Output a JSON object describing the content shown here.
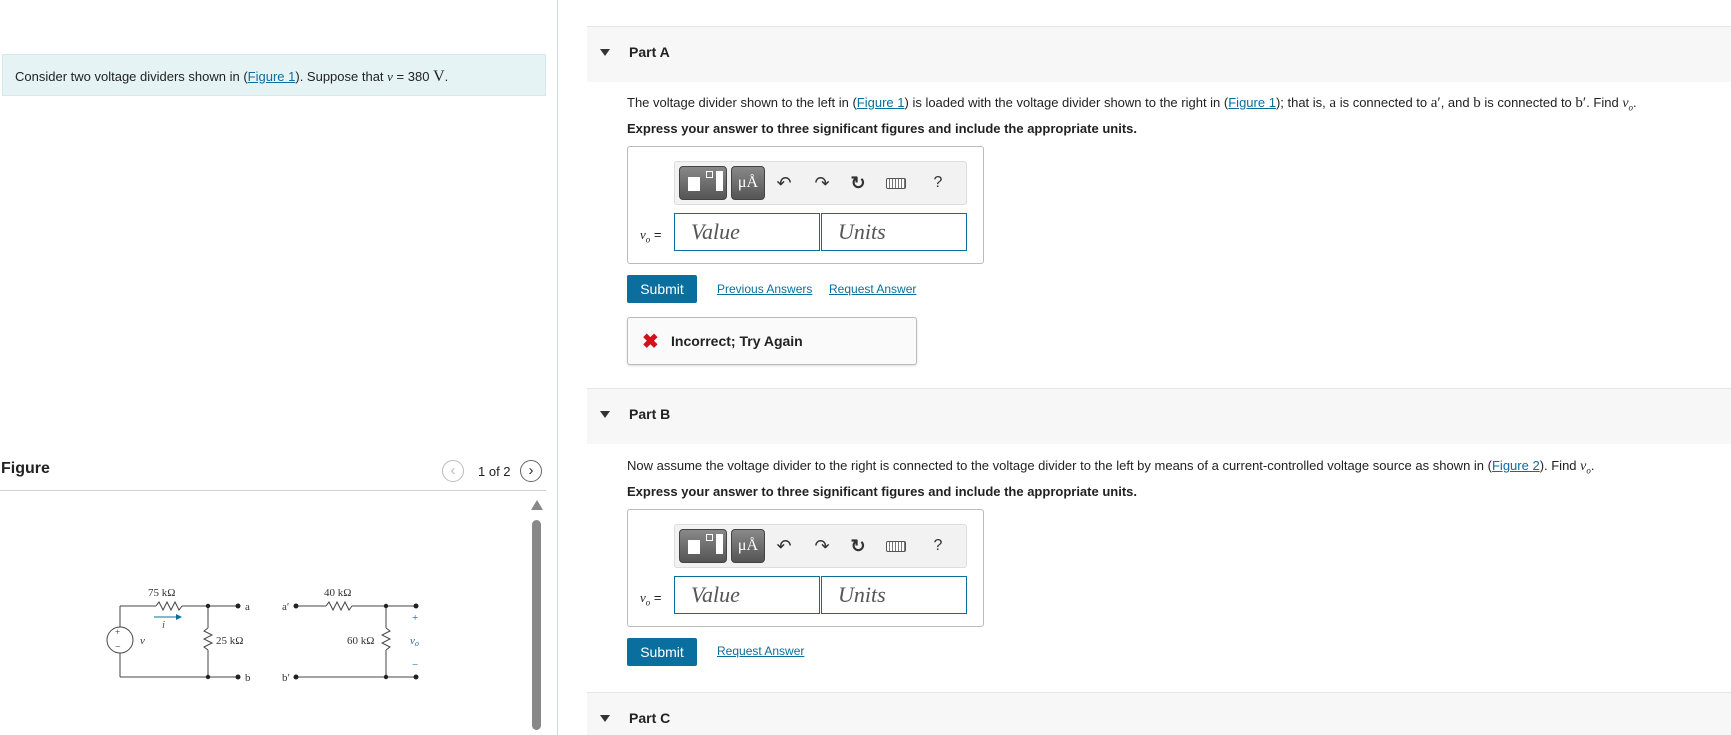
{
  "intro": {
    "text_before": "Consider two voltage dividers shown in (",
    "figure_link": "Figure 1",
    "text_mid": "). Suppose that ",
    "var": "v",
    "text_eq": " = 380 ",
    "unit": "V",
    "text_end": "."
  },
  "figure": {
    "title": "Figure",
    "pager": "1 of 2",
    "prev_icon": "chevron-left-icon",
    "next_icon": "chevron-right-icon"
  },
  "circuit": {
    "r1": "75 kΩ",
    "r2": "25 kΩ",
    "r3": "40 kΩ",
    "r4": "60 kΩ",
    "src": "v",
    "current": "i",
    "plus": "+",
    "minus": "−",
    "out": "v",
    "out_sub": "o",
    "a": "a",
    "b": "b",
    "a_prime": "a′",
    "b_prime": "b′"
  },
  "partA": {
    "name": "Part A",
    "q1": "The voltage divider shown to the left in (",
    "q_link1": "Figure 1",
    "q2": ") is loaded with the voltage divider shown to the right in (",
    "q_link2": "Figure 1",
    "q3": "); that is, ",
    "a": "a",
    "q4": " is connected to ",
    "a_prime": "a′",
    "q5": ", and ",
    "b": "b",
    "q6": " is connected to ",
    "b_prime": "b′",
    "q7": ". Find ",
    "find_var": "v",
    "find_sub": "o",
    "q8": ".",
    "instr": "Express your answer to three significant figures and include the appropriate units.",
    "eq_var": "v",
    "eq_sub": "o",
    "eq_sign": " =",
    "value_placeholder": "Value",
    "units_placeholder": "Units",
    "submit": "Submit",
    "previous_answers": "Previous Answers",
    "request_answer": "Request Answer",
    "feedback": "Incorrect; Try Again",
    "feedback_icon": "✖"
  },
  "partB": {
    "name": "Part B",
    "q1": "Now assume the voltage divider to the right is connected to the voltage divider to the left by means of a current-controlled voltage source as shown in (",
    "q_link": "Figure 2",
    "q2": "). Find ",
    "find_var": "v",
    "find_sub": "o",
    "q3": ".",
    "instr": "Express your answer to three significant figures and include the appropriate units.",
    "eq_var": "v",
    "eq_sub": "o",
    "eq_sign": " =",
    "value_placeholder": "Value",
    "units_placeholder": "Units",
    "submit": "Submit",
    "request_answer": "Request Answer"
  },
  "partC": {
    "name": "Part C"
  },
  "toolbar": {
    "units_label": "μÅ",
    "undo": "↶",
    "redo": "↷",
    "reset": "↻",
    "help": "?"
  }
}
